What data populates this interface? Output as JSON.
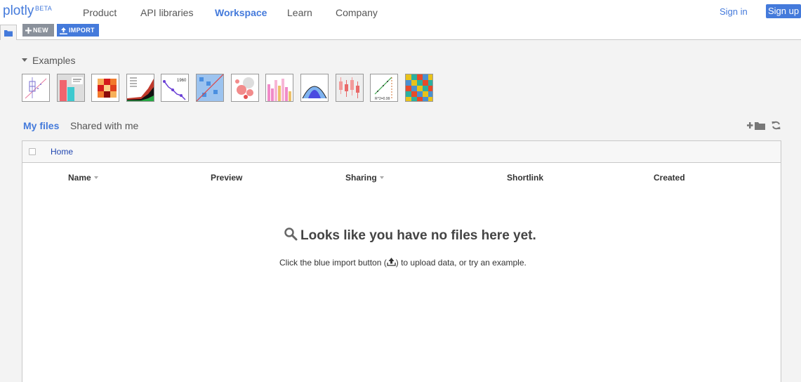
{
  "brand": {
    "name": "plotly",
    "badge": "BETA"
  },
  "nav": {
    "items": [
      {
        "label": "Product",
        "active": false
      },
      {
        "label": "API libraries",
        "active": false
      },
      {
        "label": "Workspace",
        "active": true
      },
      {
        "label": "Learn",
        "active": false
      },
      {
        "label": "Company",
        "active": false
      }
    ],
    "signin": "Sign in",
    "signup": "Sign up"
  },
  "toolbar": {
    "new_label": "NEW",
    "import_label": "IMPORT"
  },
  "examples": {
    "title": "Examples",
    "thumbnails": [
      {
        "icon": "box-plot-thumbnail"
      },
      {
        "icon": "bar-error-thumbnail"
      },
      {
        "icon": "heatmap-thumbnail"
      },
      {
        "icon": "stacked-area-thumbnail"
      },
      {
        "icon": "scatter-line-thumbnail"
      },
      {
        "icon": "scatter-matrix-thumbnail"
      },
      {
        "icon": "bubble-thumbnail"
      },
      {
        "icon": "histogram-thumbnail"
      },
      {
        "icon": "distribution-thumbnail"
      },
      {
        "icon": "box-candles-thumbnail"
      },
      {
        "icon": "fit-line-thumbnail"
      },
      {
        "icon": "color-grid-thumbnail"
      }
    ],
    "annotation_1960": "1960",
    "annotation_fit": "R^2=0.99"
  },
  "files": {
    "tab_my": "My files",
    "tab_shared": "Shared with me",
    "breadcrumb": "Home",
    "columns": {
      "name": "Name",
      "preview": "Preview",
      "sharing": "Sharing",
      "shortlink": "Shortlink",
      "created": "Created"
    },
    "empty_title": "Looks like you have no files here yet.",
    "empty_sub_before": "Click the blue import button (",
    "empty_sub_after": ") to upload data, or try an example."
  },
  "colors": {
    "accent": "#447adb",
    "link": "#2046b0",
    "new_button": "#8a919b",
    "page_bg": "#f3f3f3"
  }
}
